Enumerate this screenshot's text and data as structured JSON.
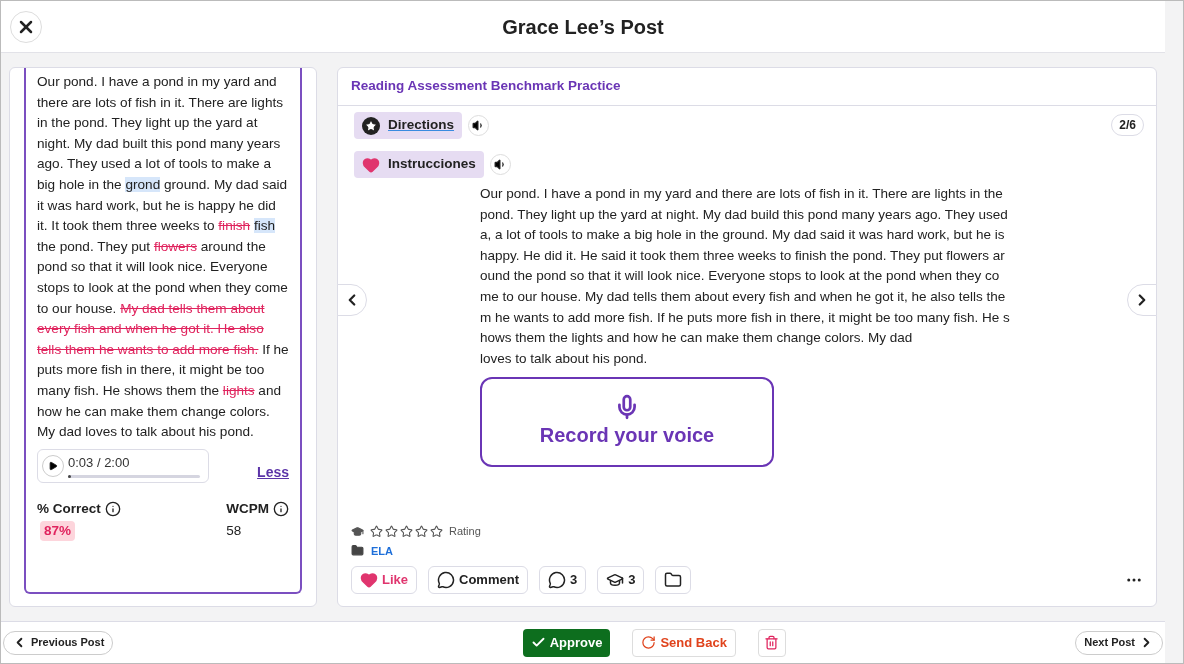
{
  "header": {
    "title": "Grace Lee’s Post"
  },
  "transcript": {
    "segments": [
      {
        "kind": "normal",
        "text": "Our pond. I have a pond in my yard and there are lots of fish in it. There are lights in the pond. They light up the yard at night. My dad built this pond many years ago. They used a lot of tools to make a big hole in the "
      },
      {
        "kind": "substituted",
        "text": "grond"
      },
      {
        "kind": "normal",
        "text": " ground. My dad said it was hard work, but he is happy he did it. It took them three weeks to "
      },
      {
        "kind": "omitted",
        "text": "finish"
      },
      {
        "kind": "substituted",
        "text": "fish"
      },
      {
        "kind": "normal",
        "text": " the pond. They put "
      },
      {
        "kind": "omitted",
        "text": "flowers"
      },
      {
        "kind": "normal",
        "text": " around the pond so that it will look nice. Everyone stops to look at the pond when they come to our house. "
      },
      {
        "kind": "omitted",
        "text": "My dad tells them about every fish and when he got it. He also tells them he wants to add more fish."
      },
      {
        "kind": "normal",
        "text": " If he puts more fish in there, it might be too many fish. He shows them the "
      },
      {
        "kind": "omitted",
        "text": "lights"
      },
      {
        "kind": "normal",
        "text": " and how he can make them change colors. My dad loves to talk about his pond."
      }
    ],
    "audio": {
      "time": "0:03 / 2:00",
      "level": 0.02
    },
    "less_link": "Less",
    "stats": [
      {
        "label": "% Correct",
        "value": "87%",
        "highlighted": true
      },
      {
        "label": "WCPM",
        "value": "58",
        "highlighted": false
      }
    ]
  },
  "post": {
    "title": "Reading Assessment Benchmark Practice",
    "page": "2/6",
    "prompts": [
      {
        "kind": "directions",
        "label": "Directions"
      },
      {
        "kind": "instructions",
        "label": "Instrucciones"
      }
    ],
    "passage": [
      "Our pond. I have a pond in my yard and there are lots of fish in it. There are lights in the pond. They light up the yard at night. My dad build this pond many years ago. They used a, a lot of tools to make a big hole in the ground. My dad said it was hard work, but he is happy. He did it. He said it took them three weeks to finish the pond. They put flowers around the pond so that it will look nice. Everyone stops to look at the pond when they come to our house. My dad tells them about every fish and when he got it, he also tells them he wants to add more fish. If he puts more fish in there, it might be too many fish. He shows them the lights and how he can make them change colors. My dad",
      "loves to talk about his pond."
    ],
    "record_button": "Record your voice",
    "rating": {
      "stars": 0,
      "label": "Rating"
    },
    "folder": "ELA",
    "actions": [
      {
        "kind": "like",
        "label": "Like"
      },
      {
        "kind": "comment",
        "label": "Comment"
      },
      {
        "kind": "teacher-comments",
        "label": "3"
      },
      {
        "kind": "students",
        "label": "3"
      },
      {
        "kind": "folder"
      }
    ]
  },
  "footer": {
    "previous": "Previous Post",
    "approve": "Approve",
    "send_back": "Send Back",
    "next": "Next Post"
  }
}
